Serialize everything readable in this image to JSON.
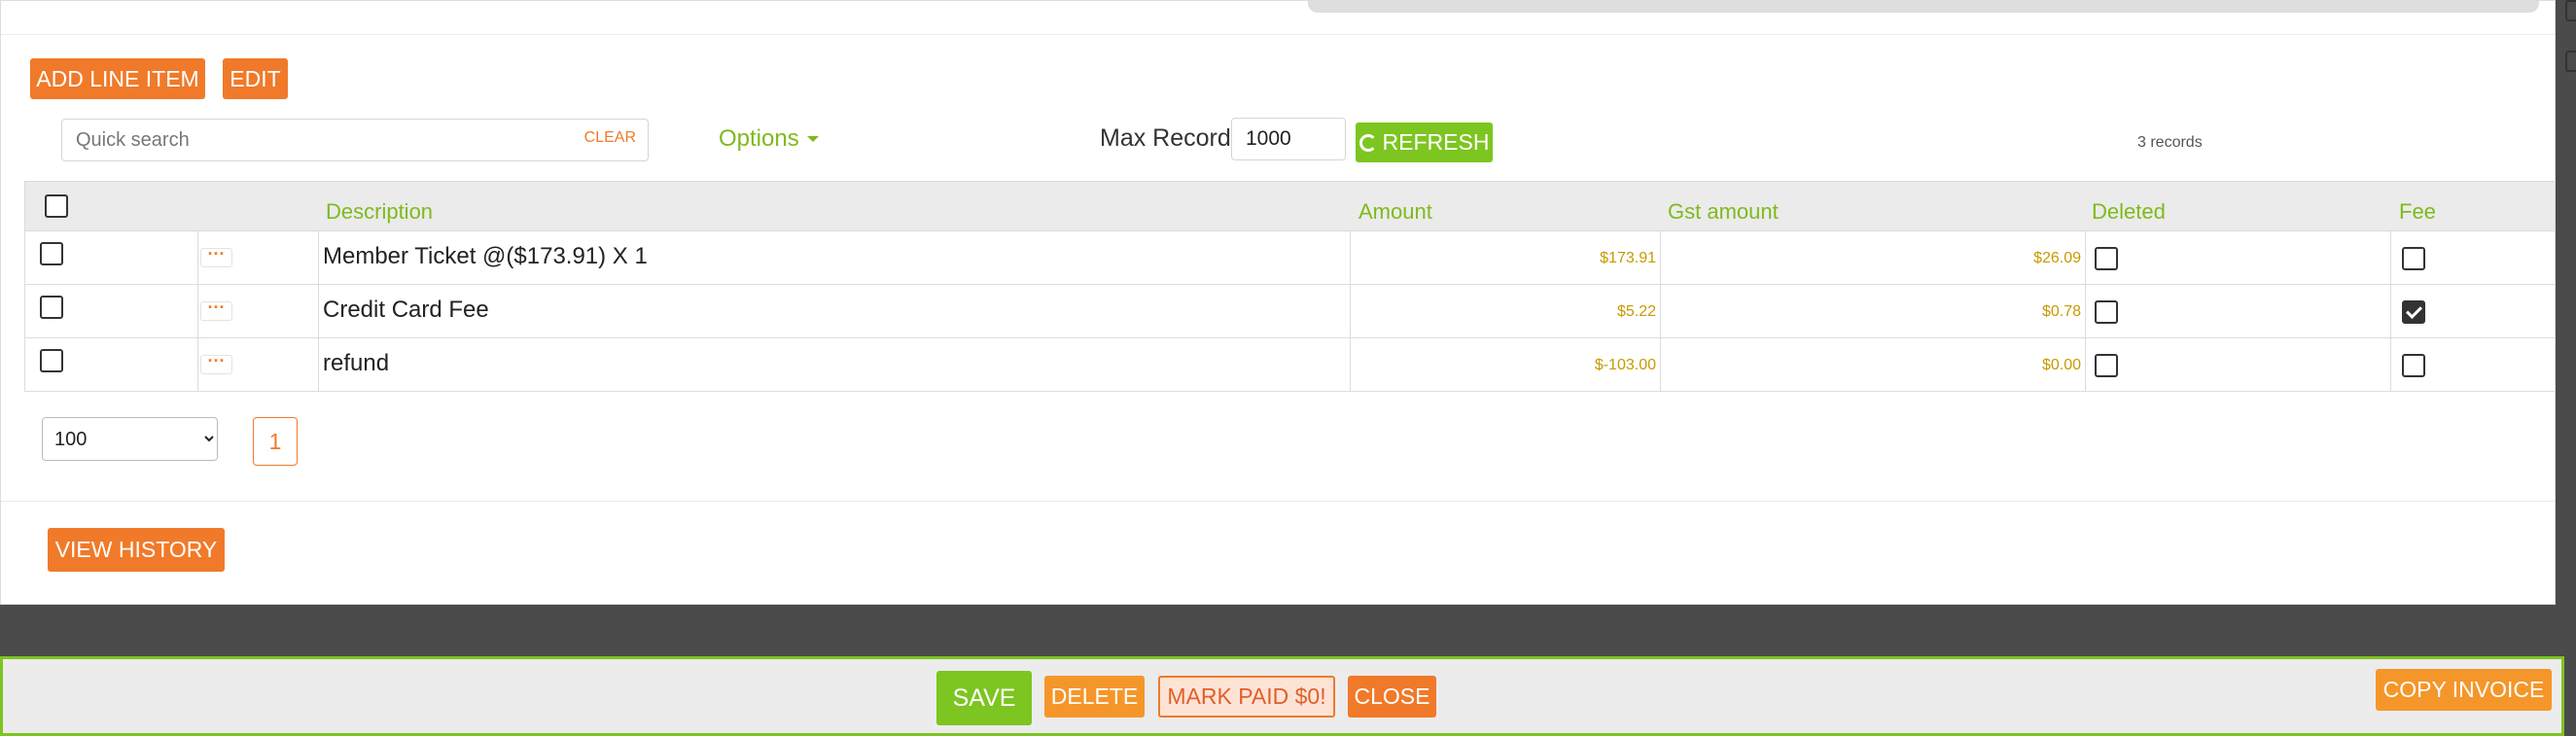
{
  "toolbar": {
    "add_line_item": "ADD LINE ITEM",
    "edit": "EDIT"
  },
  "search": {
    "placeholder": "Quick search",
    "value": "",
    "clear": "CLEAR"
  },
  "options_label": "Options",
  "max_records": {
    "label": "Max Records",
    "value": "1000"
  },
  "refresh_label": "REFRESH",
  "record_count": "3 records",
  "table": {
    "headers": {
      "description": "Description",
      "amount": "Amount",
      "gst_amount": "Gst amount",
      "deleted": "Deleted",
      "fee": "Fee"
    },
    "rows": [
      {
        "description": "Member Ticket @($173.91) X 1",
        "amount": "$173.91",
        "gst_amount": "$26.09",
        "deleted": false,
        "fee": false
      },
      {
        "description": "Credit Card Fee",
        "amount": "$5.22",
        "gst_amount": "$0.78",
        "deleted": false,
        "fee": true
      },
      {
        "description": "refund",
        "amount": "$-103.00",
        "gst_amount": "$0.00",
        "deleted": false,
        "fee": false
      }
    ]
  },
  "pagination": {
    "page_size": "100",
    "page_size_options": [
      "100"
    ],
    "current_page": "1"
  },
  "view_history": "VIEW HISTORY",
  "footer": {
    "save": "SAVE",
    "delete": "DELETE",
    "mark_paid": "MARK PAID $0!",
    "close": "CLOSE",
    "copy_invoice": "COPY INVOICE"
  },
  "colors": {
    "accent_orange": "#f07a2a",
    "accent_green": "#7dc520",
    "header_green": "#7fba1c",
    "amount_gold": "#c79a00"
  }
}
